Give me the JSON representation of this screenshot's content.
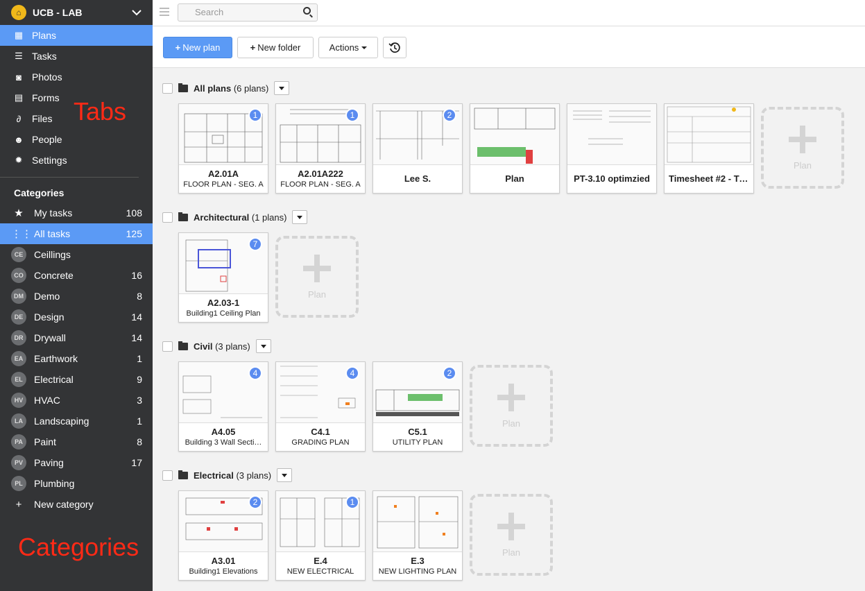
{
  "app": {
    "workspace": "UCB - LAB"
  },
  "nav": [
    {
      "label": "Plans",
      "icon": "plans-icon"
    },
    {
      "label": "Tasks",
      "icon": "list-icon"
    },
    {
      "label": "Photos",
      "icon": "camera-icon"
    },
    {
      "label": "Forms",
      "icon": "forms-icon"
    },
    {
      "label": "Files",
      "icon": "paperclip-icon"
    },
    {
      "label": "People",
      "icon": "people-icon"
    },
    {
      "label": "Settings",
      "icon": "gear-icon"
    }
  ],
  "categories_title": "Categories",
  "categories": [
    {
      "abbr": "★",
      "label": "My tasks",
      "count": "108"
    },
    {
      "abbr": "⋮⋮",
      "label": "All tasks",
      "count": "125"
    },
    {
      "abbr": "CE",
      "label": "Ceillings",
      "count": ""
    },
    {
      "abbr": "CO",
      "label": "Concrete",
      "count": "16"
    },
    {
      "abbr": "DM",
      "label": "Demo",
      "count": "8"
    },
    {
      "abbr": "DE",
      "label": "Design",
      "count": "14"
    },
    {
      "abbr": "DR",
      "label": "Drywall",
      "count": "14"
    },
    {
      "abbr": "EA",
      "label": "Earthwork",
      "count": "1"
    },
    {
      "abbr": "EL",
      "label": "Electrical",
      "count": "9"
    },
    {
      "abbr": "HV",
      "label": "HVAC",
      "count": "3"
    },
    {
      "abbr": "LA",
      "label": "Landscaping",
      "count": "1"
    },
    {
      "abbr": "PA",
      "label": "Paint",
      "count": "8"
    },
    {
      "abbr": "PV",
      "label": "Paving",
      "count": "17"
    },
    {
      "abbr": "PL",
      "label": "Plumbing",
      "count": ""
    }
  ],
  "new_category": "New category",
  "annotations": {
    "tabs": "Tabs",
    "categories": "Categories"
  },
  "search": {
    "placeholder": "Search"
  },
  "toolbar": {
    "new_plan": "New plan",
    "new_folder": "New folder",
    "actions": "Actions"
  },
  "add_plan_label": "Plan",
  "folders": [
    {
      "name": "All plans",
      "count": "(6 plans)",
      "plans": [
        {
          "name": "A2.01A",
          "desc": "FLOOR PLAN - SEG. A",
          "badge": "1"
        },
        {
          "name": "A2.01A222",
          "desc": "FLOOR PLAN - SEG. A",
          "badge": "1"
        },
        {
          "name": "Lee S.",
          "desc": "",
          "badge": "2"
        },
        {
          "name": "Plan",
          "desc": "",
          "badge": ""
        },
        {
          "name": "PT-3.10 optimzied",
          "desc": "",
          "badge": ""
        },
        {
          "name": "Timesheet #2 - Ti…",
          "desc": "",
          "badge": ""
        }
      ]
    },
    {
      "name": "Architectural",
      "count": "(1 plans)",
      "plans": [
        {
          "name": "A2.03-1",
          "desc": "Building1 Ceiling Plan",
          "badge": "7"
        }
      ]
    },
    {
      "name": "Civil",
      "count": "(3 plans)",
      "plans": [
        {
          "name": "A4.05",
          "desc": "Building 3 Wall Secti…",
          "badge": "4"
        },
        {
          "name": "C4.1",
          "desc": "GRADING PLAN",
          "badge": "4"
        },
        {
          "name": "C5.1",
          "desc": "UTILITY PLAN",
          "badge": "2"
        }
      ]
    },
    {
      "name": "Electrical",
      "count": "(3 plans)",
      "plans": [
        {
          "name": "A3.01",
          "desc": "Building1 Elevations",
          "badge": "2"
        },
        {
          "name": "E.4",
          "desc": "NEW ELECTRICAL",
          "badge": "1"
        },
        {
          "name": "E.3",
          "desc": "NEW LIGHTING PLAN",
          "badge": ""
        }
      ]
    }
  ]
}
